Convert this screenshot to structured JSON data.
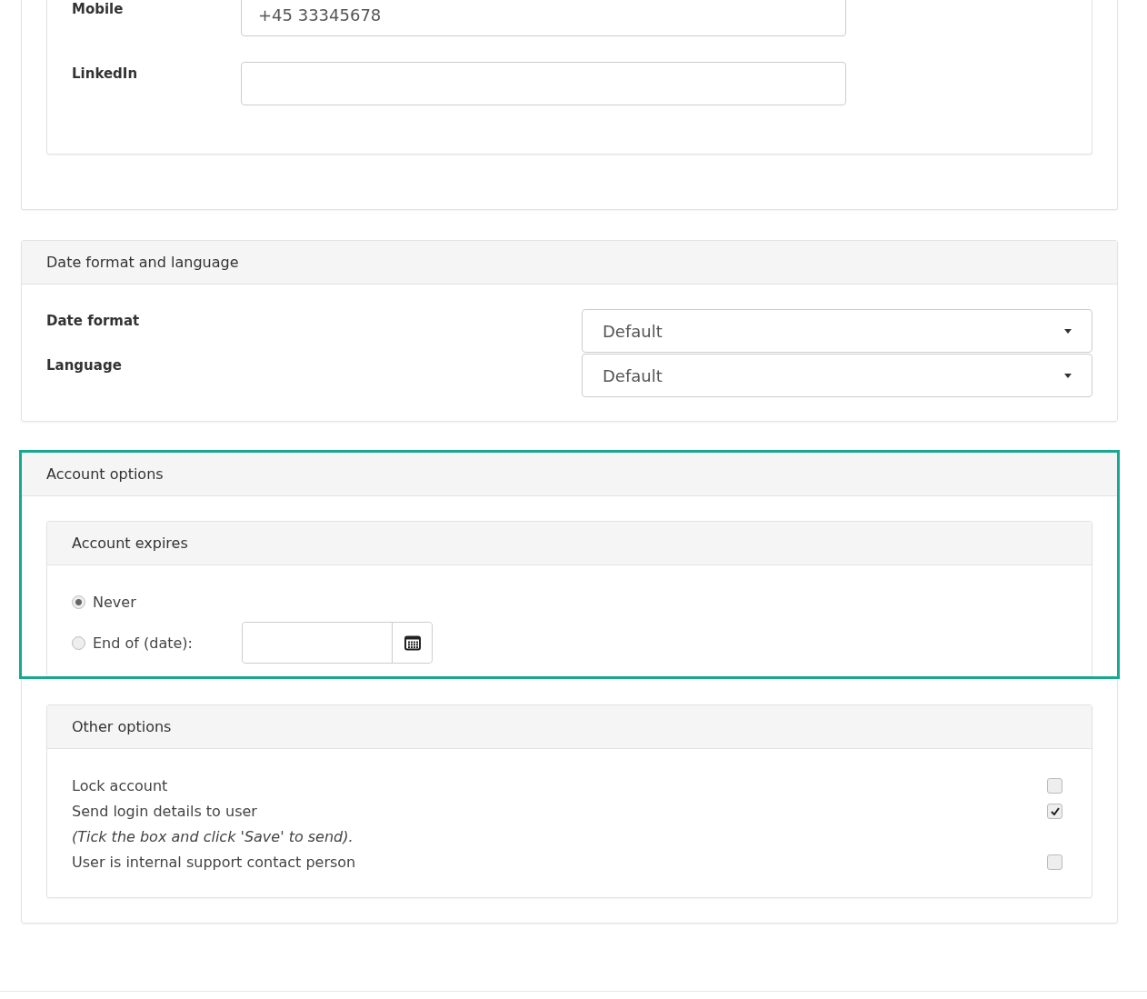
{
  "contact": {
    "fields": [
      {
        "label": "Mobile",
        "value": "+45 33345678"
      },
      {
        "label": "LinkedIn"
      }
    ]
  },
  "date_language": {
    "title": "Date format and language",
    "selects": [
      {
        "label": "Date format",
        "value": "Default"
      },
      {
        "label": "Language",
        "value": "Default"
      }
    ]
  },
  "account_options": {
    "title": "Account options",
    "highlighted": true,
    "expires": {
      "title": "Account expires",
      "options": [
        {
          "label": "Never",
          "selected": true,
          "kind": "plain"
        },
        {
          "label": "End of (date):",
          "selected": false,
          "kind": "date"
        }
      ]
    },
    "other": {
      "title": "Other options",
      "rows": [
        {
          "label": "Lock account",
          "checked": false,
          "kind": "check"
        },
        {
          "label": "Send login details to user",
          "checked": true,
          "kind": "check"
        },
        {
          "label": "(Tick the box and click 'Save' to send).",
          "kind": "note"
        },
        {
          "label": "User is internal support contact person",
          "checked": false,
          "kind": "check"
        }
      ]
    }
  }
}
